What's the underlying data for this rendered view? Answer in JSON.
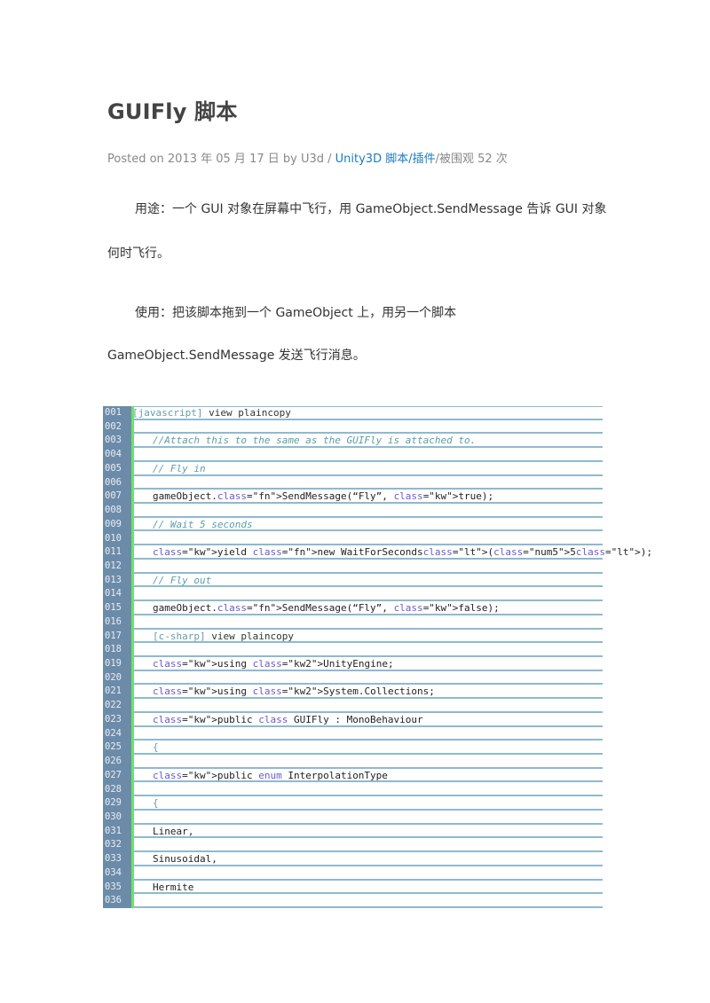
{
  "article": {
    "title": "GUIFly 脚本",
    "meta_prefix": "Posted on 2013 年 05 月 17 日 by U3d / ",
    "meta_category": "Unity3D 脚本/插件",
    "meta_suffix": "/被围观 52 次",
    "para1_line1": "用途：一个 GUI 对象在屏幕中飞行，用 GameObject.SendMessage 告诉 GUI 对象",
    "para1_line2": "何时飞行。",
    "para2_line1": "使用：把该脚本拖到一个 GameObject 上，用另一个脚本",
    "para2_line2": "GameObject.SendMessage 发送飞行消息。"
  },
  "code": {
    "header": "[javascript] view plaincopy",
    "lines": [
      {
        "n": "001",
        "html": "[javascript] view plaincopy"
      },
      {
        "n": "002",
        "html": ""
      },
      {
        "n": "003",
        "html": "//Attach this to the same as the GUIFly is attached to."
      },
      {
        "n": "004",
        "html": ""
      },
      {
        "n": "005",
        "html": "// Fly in"
      },
      {
        "n": "006",
        "html": ""
      },
      {
        "n": "007",
        "html": "gameObject.SendMessage(“Fly”, true);"
      },
      {
        "n": "008",
        "html": ""
      },
      {
        "n": "009",
        "html": "// Wait 5 seconds"
      },
      {
        "n": "010",
        "html": ""
      },
      {
        "n": "011",
        "html": "yield new WaitForSeconds(5);"
      },
      {
        "n": "012",
        "html": ""
      },
      {
        "n": "013",
        "html": "// Fly out"
      },
      {
        "n": "014",
        "html": ""
      },
      {
        "n": "015",
        "html": "gameObject.SendMessage(“Fly”, false);"
      },
      {
        "n": "016",
        "html": ""
      },
      {
        "n": "017",
        "html": "[c-sharp] view plaincopy"
      },
      {
        "n": "018",
        "html": ""
      },
      {
        "n": "019",
        "html": "using UnityEngine;"
      },
      {
        "n": "020",
        "html": ""
      },
      {
        "n": "021",
        "html": "using System.Collections;"
      },
      {
        "n": "022",
        "html": ""
      },
      {
        "n": "023",
        "html": "public class GUIFly : MonoBehaviour"
      },
      {
        "n": "024",
        "html": ""
      },
      {
        "n": "025",
        "html": "{"
      },
      {
        "n": "026",
        "html": ""
      },
      {
        "n": "027",
        "html": "public enum InterpolationType"
      },
      {
        "n": "028",
        "html": ""
      },
      {
        "n": "029",
        "html": "{"
      },
      {
        "n": "030",
        "html": ""
      },
      {
        "n": "031",
        "html": "Linear,"
      },
      {
        "n": "032",
        "html": ""
      },
      {
        "n": "033",
        "html": "Sinusoidal,"
      },
      {
        "n": "034",
        "html": ""
      },
      {
        "n": "035",
        "html": "Hermite"
      },
      {
        "n": "036",
        "html": ""
      }
    ]
  },
  "colors": {
    "gutter": "#6c8ba8",
    "gutter_accent": "#6ce26c",
    "rule": "#8fb9cf",
    "link": "#1a7bbf",
    "keyword": "#1a1a9c",
    "comment": "#5b9ea8"
  }
}
